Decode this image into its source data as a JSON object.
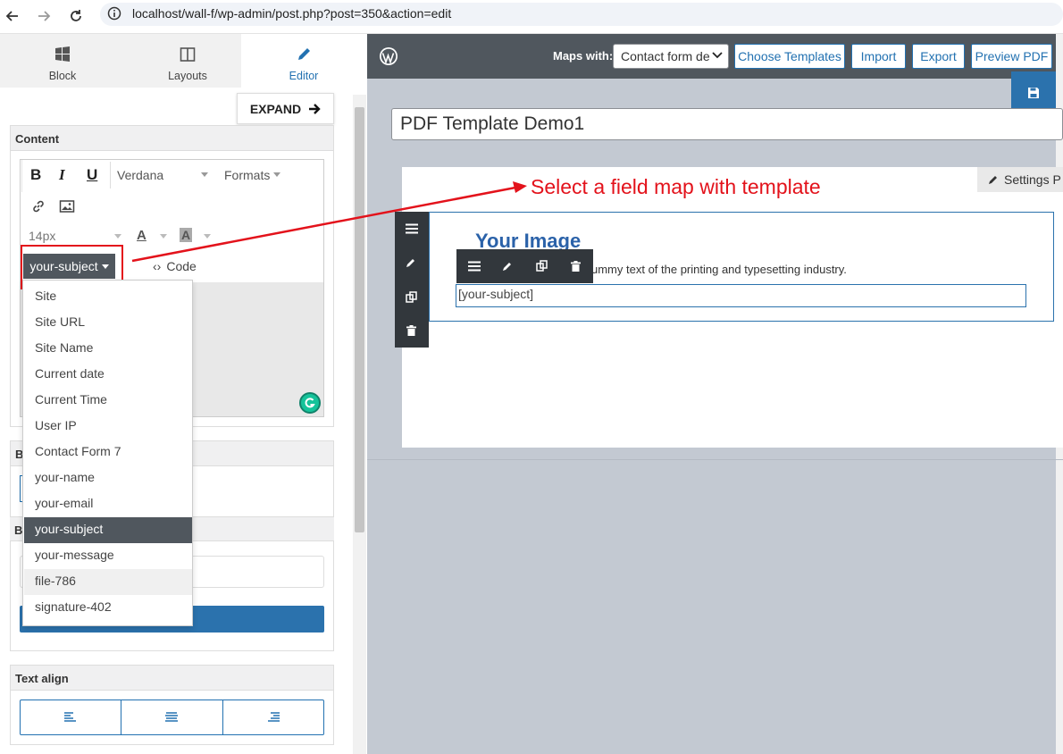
{
  "browser": {
    "url": "localhost/wall-f/wp-admin/post.php?post=350&action=edit"
  },
  "tabs": [
    {
      "label": "Block",
      "icon": "windows-grid-icon"
    },
    {
      "label": "Layouts",
      "icon": "layout-icon"
    },
    {
      "label": "Editor",
      "icon": "pencil-icon"
    }
  ],
  "expand_label": "EXPAND",
  "content": {
    "heading": "Content",
    "toolbar": {
      "bold": "B",
      "italic": "I",
      "underline": "U",
      "font_family": "Verdana",
      "formats": "Formats",
      "font_size": "14px",
      "text_color": "A",
      "bg_color": "A",
      "variable_button": "your-subject",
      "code_label": "Code"
    }
  },
  "dropdown_items": [
    "Site",
    "Site URL",
    "Site Name",
    "Current date",
    "Current Time",
    "User IP",
    "Contact Form 7",
    "your-name",
    "your-email",
    "your-subject",
    "your-message",
    "file-786",
    "signature-402"
  ],
  "dropdown_selected": "your-subject",
  "dropdown_hovered": "file-786",
  "partial_labels": {
    "a": "B",
    "b": "B"
  },
  "text_align": {
    "heading": "Text align"
  },
  "annotation": {
    "text": "Select a field map with template",
    "color": "#e3121b"
  },
  "topbar": {
    "maps_with_label": "Maps with:",
    "maps_with_value": "Contact form de",
    "choose_templates": "Choose Templates",
    "import": "Import",
    "export": "Export",
    "preview_pdf": "Preview PDF"
  },
  "doc": {
    "title": "PDF Template Demo1",
    "settings_label": "Settings P",
    "image_text": "Your Image",
    "body_text": "ummy text of the printing and typesetting industry.",
    "field_text": "[your-subject]"
  },
  "colors": {
    "accent": "#2271b1",
    "dark": "#50575e",
    "canvas": "#c3c9d2",
    "annotation": "#e3121b"
  }
}
